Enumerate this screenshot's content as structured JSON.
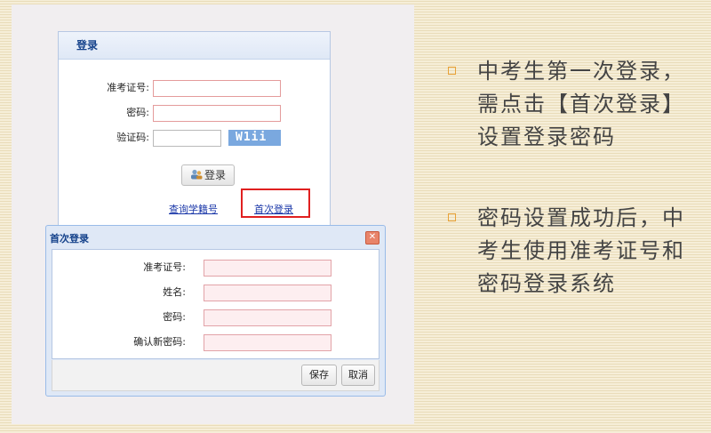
{
  "login": {
    "title": "登录",
    "ticket_label": "准考证号:",
    "password_label": "密码:",
    "captcha_label": "验证码:",
    "captcha_text": "W1ii",
    "login_button": "登录",
    "query_link": "查询学籍号",
    "first_login_link": "首次登录"
  },
  "dialog": {
    "title": "首次登录",
    "ticket_label": "准考证号:",
    "name_label": "姓名:",
    "password_label": "密码:",
    "confirm_label": "确认新密码:",
    "save_button": "保存",
    "cancel_button": "取消"
  },
  "bullets": [
    {
      "text": "中考生第一次登录，\n需点击【首次登录】\n设置登录密码"
    },
    {
      "text": "密码设置成功后，中\n考生使用准考证号和\n密码登录系统"
    }
  ],
  "colors": {
    "accent_red": "#e02020",
    "header_text": "#15428b",
    "bullet_marker": "#e8a238"
  },
  "icons": {
    "login_button_icon": "user-group-icon",
    "dialog_close": "close-icon",
    "bullet_marker": "square-bullet-icon"
  }
}
